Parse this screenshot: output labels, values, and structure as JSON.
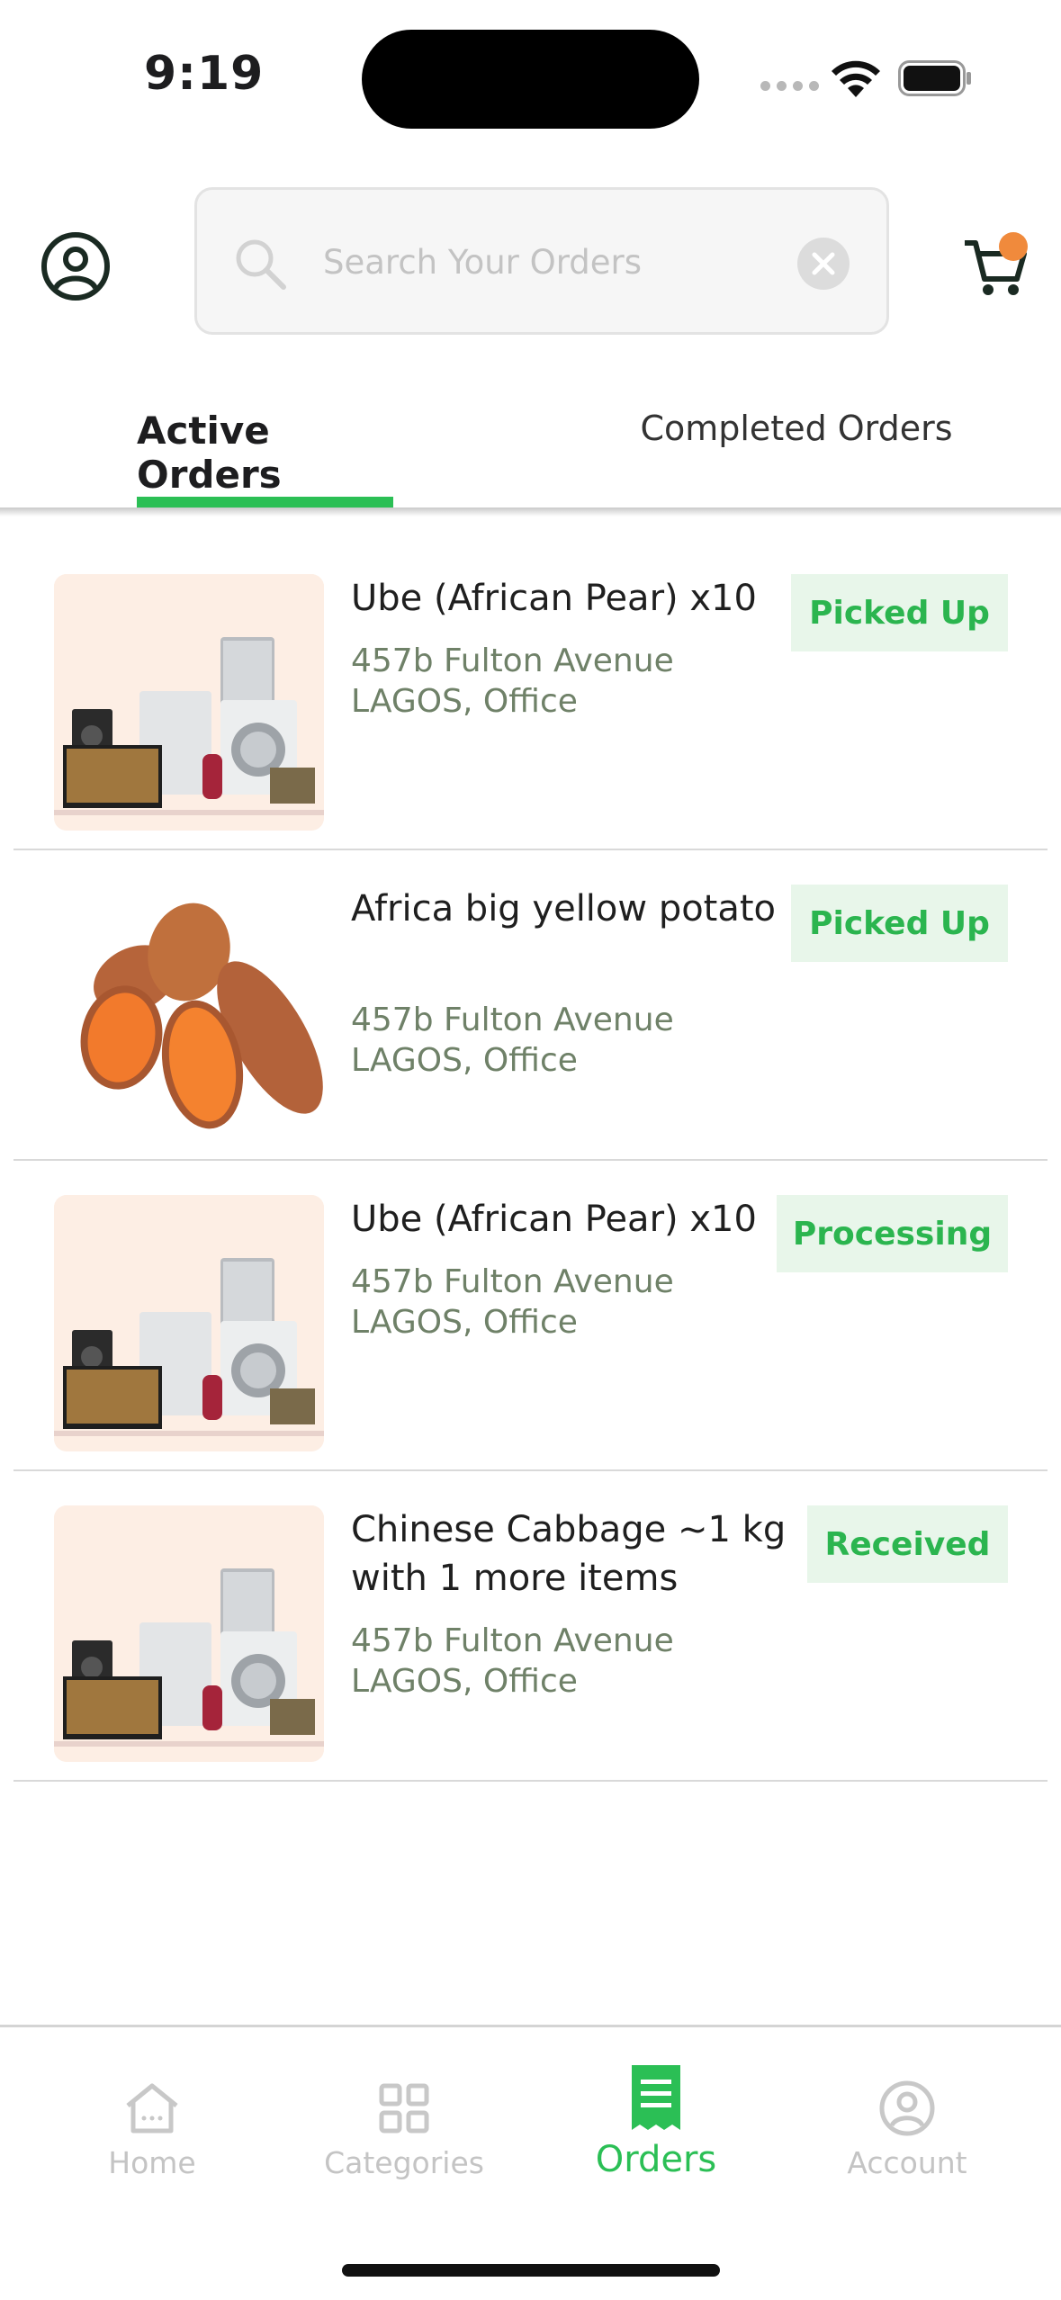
{
  "status_bar": {
    "time": "9:19"
  },
  "header": {
    "search": {
      "placeholder": "Search Your Orders",
      "value": ""
    },
    "cart_badge_color": "#f08a3c"
  },
  "tabs": [
    {
      "label": "Active Orders",
      "active": true
    },
    {
      "label": "Completed Orders",
      "active": false
    }
  ],
  "orders": [
    {
      "title": "Ube (African Pear) x10",
      "address_line1": "457b Fulton Avenue",
      "address_line2": "LAGOS, Office",
      "status": "Picked Up",
      "image": "appliances-image"
    },
    {
      "title": "Africa big yellow potato",
      "address_line1": "457b Fulton Avenue",
      "address_line2": "LAGOS, Office",
      "status": "Picked Up",
      "image": "sweet-potato-image"
    },
    {
      "title": "Ube (African Pear) x10",
      "address_line1": "457b Fulton Avenue",
      "address_line2": "LAGOS, Office",
      "status": "Processing",
      "image": "appliances-image"
    },
    {
      "title": "Chinese Cabbage ~1 kg with 1 more items",
      "address_line1": "457b Fulton Avenue",
      "address_line2": "LAGOS, Office",
      "status": "Received",
      "image": "appliances-image"
    }
  ],
  "bottom_nav": [
    {
      "label": "Home",
      "icon": "home-icon",
      "active": false
    },
    {
      "label": "Categories",
      "icon": "grid-icon",
      "active": false
    },
    {
      "label": "Orders",
      "icon": "receipt-icon",
      "active": true
    },
    {
      "label": "Account",
      "icon": "account-icon",
      "active": false
    }
  ],
  "colors": {
    "accent": "#2bbf55",
    "badge_bg": "#e8f6ea",
    "address": "#6f8168"
  }
}
